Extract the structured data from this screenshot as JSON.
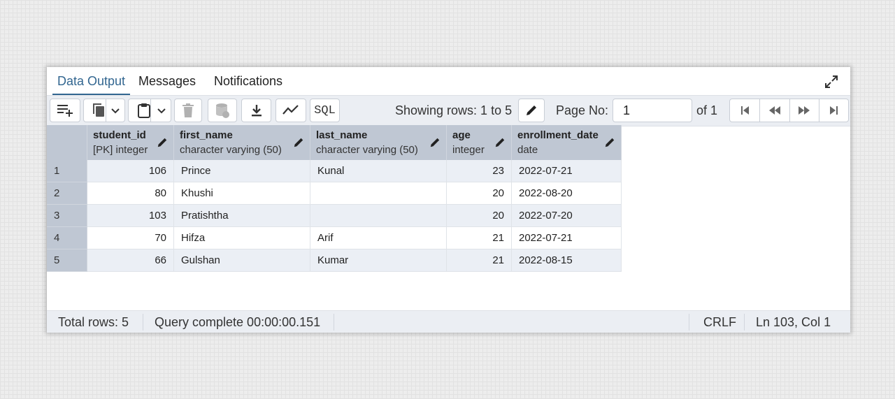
{
  "tabs": [
    {
      "label": "Data Output",
      "active": true
    },
    {
      "label": "Messages",
      "active": false
    },
    {
      "label": "Notifications",
      "active": false
    }
  ],
  "toolbar": {
    "buttons": [
      "add-row-icon",
      "copy-icon",
      "chevron-down-icon",
      "paste-icon",
      "chevron-down-icon",
      "delete-icon",
      "save-data-icon",
      "download-icon",
      "graph-icon"
    ],
    "sql_label": "SQL",
    "showing_rows": "Showing rows: 1 to 5",
    "page_label": "Page No:",
    "page_value": "1",
    "page_of": "of 1"
  },
  "columns": [
    {
      "name": "student_id",
      "type": "[PK] integer"
    },
    {
      "name": "first_name",
      "type": "character varying (50)"
    },
    {
      "name": "last_name",
      "type": "character varying (50)"
    },
    {
      "name": "age",
      "type": "integer"
    },
    {
      "name": "enrollment_date",
      "type": "date"
    }
  ],
  "rows": [
    {
      "n": "1",
      "student_id": "106",
      "first_name": "Prince",
      "last_name": "Kunal",
      "age": "23",
      "enrollment_date": "2022-07-21"
    },
    {
      "n": "2",
      "student_id": "80",
      "first_name": "Khushi",
      "last_name": "",
      "age": "20",
      "enrollment_date": "2022-08-20"
    },
    {
      "n": "3",
      "student_id": "103",
      "first_name": "Pratishtha",
      "last_name": "",
      "age": "20",
      "enrollment_date": "2022-07-20"
    },
    {
      "n": "4",
      "student_id": "70",
      "first_name": "Hifza",
      "last_name": "Arif",
      "age": "21",
      "enrollment_date": "2022-07-21"
    },
    {
      "n": "5",
      "student_id": "66",
      "first_name": "Gulshan",
      "last_name": "Kumar",
      "age": "21",
      "enrollment_date": "2022-08-15"
    }
  ],
  "status": {
    "total_rows": "Total rows: 5",
    "query": "Query complete 00:00:00.151",
    "eol": "CRLF",
    "position": "Ln 103, Col 1"
  },
  "colors": {
    "accent": "#326690",
    "header_bg": "#bfc7d3",
    "toolbar_bg": "#ebeef3"
  }
}
